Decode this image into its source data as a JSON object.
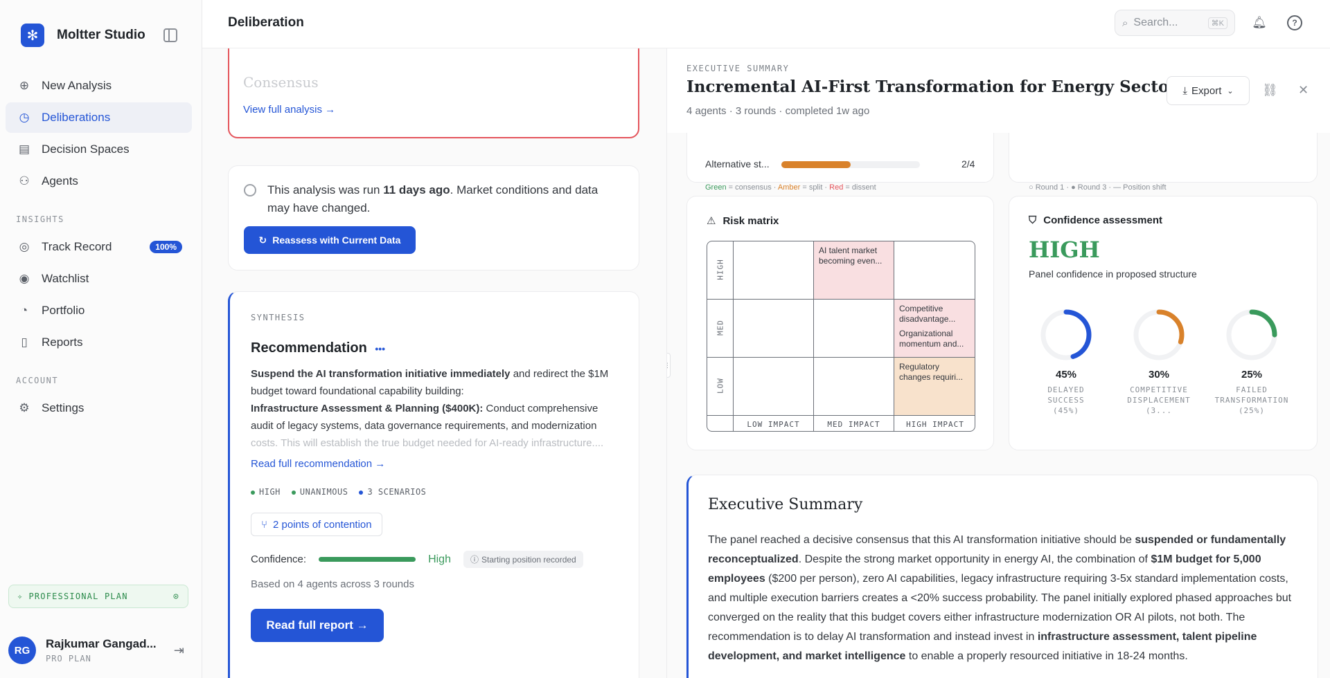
{
  "app": {
    "name": "Moltter Studio"
  },
  "nav": {
    "items": [
      {
        "label": "New Analysis",
        "icon": "plus-circle-icon"
      },
      {
        "label": "Deliberations",
        "icon": "clock-icon",
        "active": true
      },
      {
        "label": "Decision Spaces",
        "icon": "chart-icon"
      },
      {
        "label": "Agents",
        "icon": "users-icon"
      }
    ],
    "insights_label": "INSIGHTS",
    "insights": [
      {
        "label": "Track Record",
        "icon": "target-icon",
        "badge": "100%"
      },
      {
        "label": "Watchlist",
        "icon": "eye-icon"
      },
      {
        "label": "Portfolio",
        "icon": "pie-icon"
      },
      {
        "label": "Reports",
        "icon": "document-icon"
      }
    ],
    "account_label": "ACCOUNT",
    "account": [
      {
        "label": "Settings",
        "icon": "gear-icon"
      }
    ]
  },
  "plan": {
    "label": "PROFESSIONAL PLAN"
  },
  "user": {
    "initials": "RG",
    "name": "Rajkumar Gangad...",
    "plan": "PRO PLAN"
  },
  "topbar": {
    "title": "Deliberation",
    "search_placeholder": "Search...",
    "search_shortcut": "⌘K"
  },
  "middle": {
    "faded_heading": "Consensus",
    "view_full": "View full analysis →",
    "notice": {
      "pre": "This analysis was run ",
      "bold": "11 days ago",
      "post": ". Market conditions and data may have changed."
    },
    "reassess": "Reassess with Current Data",
    "synthesis": {
      "label": "SYNTHESIS",
      "title": "Recommendation",
      "p1_bold": "Suspend the AI transformation initiative immediately",
      "p1_rest": " and redirect the $1M budget toward foundational capability building:",
      "p2_bold": "Infrastructure Assessment & Planning ($400K):",
      "p2_rest": " Conduct comprehensive audit of legacy systems, data governance requirements, and modernization",
      "p2_fade": "costs. This will establish the true budget needed for AI-ready infrastructure....",
      "read_more": "Read full recommendation →",
      "tags": [
        {
          "label": "HIGH",
          "color": "#3a9a5c"
        },
        {
          "label": "UNANIMOUS",
          "color": "#3a9a5c"
        },
        {
          "label": "3 SCENARIOS",
          "color": "#2455d6"
        }
      ],
      "contention": "2 points of contention",
      "confidence_label": "Confidence:",
      "confidence_value": "High",
      "position_pill": "Starting position recorded",
      "based_on": "Based on 4 agents across 3 rounds",
      "read_report": "Read full report →"
    }
  },
  "panel": {
    "label": "EXECUTIVE SUMMARY",
    "title": "Incremental AI-First Transformation for Energy Sector",
    "meta": "4 agents · 3 rounds · completed 1w ago",
    "export": "Export",
    "top_left": {
      "row_label": "Alternative st...",
      "row_value": "2/4",
      "row_fraction": 0.5,
      "legend": {
        "green": "Green",
        "green_t": " = consensus · ",
        "amber": "Amber",
        "amber_t": " = split · ",
        "red": "Red",
        "red_t": " = dissent"
      }
    },
    "top_right": {
      "legend": "○ Round 1 · ● Round 3 · — Position shift"
    },
    "risk": {
      "title": "Risk matrix",
      "y_labels": [
        "HIGH",
        "MED",
        "LOW"
      ],
      "x_labels": [
        "LOW IMPACT",
        "MED IMPACT",
        "HIGH IMPACT"
      ],
      "cells": {
        "high_med": "AI talent market becoming even...",
        "med_high_1": "Competitive disadvantage...",
        "med_high_2": "Organizational momentum and...",
        "low_high": "Regulatory changes requiri..."
      }
    },
    "confidence": {
      "title": "Confidence assessment",
      "level": "HIGH",
      "subtitle": "Panel confidence in proposed structure",
      "donuts": [
        {
          "pct": "45%",
          "value": 0.45,
          "label_1": "DELAYED SUCCESS",
          "label_2": "(45%)",
          "color": "#2455d6"
        },
        {
          "pct": "30%",
          "value": 0.3,
          "label_1": "COMPETITIVE",
          "label_2": "DISPLACEMENT (3...",
          "color": "#d9822b"
        },
        {
          "pct": "25%",
          "value": 0.25,
          "label_1": "FAILED",
          "label_2": "TRANSFORMATION",
          "label_3": "(25%)",
          "color": "#3a9a5c"
        }
      ]
    },
    "executive": {
      "title": "Executive Summary",
      "t1": "The panel reached a decisive consensus that this AI transformation initiative should be ",
      "b1": "suspended or fundamentally reconceptualized",
      "t2": ". Despite the strong market opportunity in energy AI, the combination of ",
      "b2": "$1M budget for 5,000 employees",
      "t3": " ($200 per person), zero AI capabilities, legacy infrastructure requiring 3-5x standard implementation costs, and multiple execution barriers creates a <20% success probability. The panel initially explored phased approaches but converged on the reality that this budget covers either infrastructure modernization OR AI pilots, not both. The recommendation is to delay AI transformation and instead invest in ",
      "b3": "infrastructure assessment, talent pipeline development, and market intelligence",
      "t4": " to enable a properly resourced initiative in 18-24 months."
    }
  }
}
